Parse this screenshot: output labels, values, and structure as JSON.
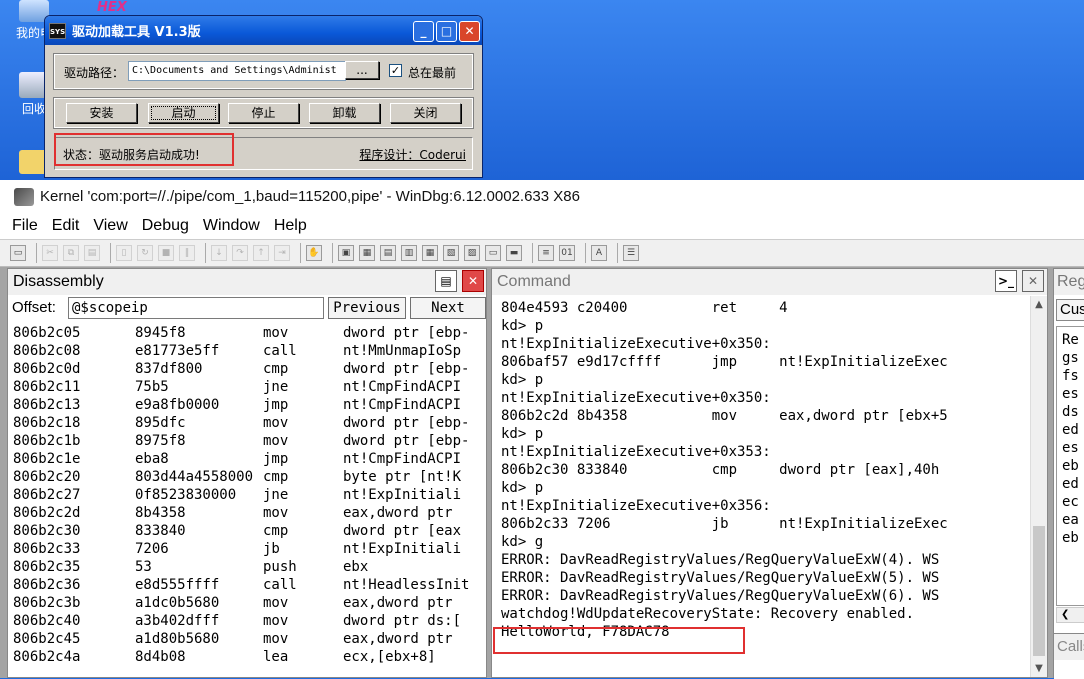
{
  "desktop": {
    "icon1_label": "我的电",
    "icon2_label": "回收",
    "hex_logo": "HEX"
  },
  "loader": {
    "title": "驱动加载工具 V1.3版",
    "app_icon": "SYS",
    "path_label": "驱动路径：",
    "path_value": "C:\\Documents and Settings\\Administ",
    "browse_label": "...",
    "topmost_label": "总在最前",
    "buttons": [
      "安装",
      "启动",
      "停止",
      "卸载",
      "关闭"
    ],
    "status": "状态：驱动服务启动成功!",
    "credit": "程序设计：Coderui",
    "titlebar_buttons": [
      "_",
      "□",
      "✕"
    ]
  },
  "windbg": {
    "title": "Kernel 'com:port=//./pipe/com_1,baud=115200,pipe' - WinDbg:6.12.0002.633 X86",
    "menu": [
      "File",
      "Edit",
      "View",
      "Debug",
      "Window",
      "Help"
    ]
  },
  "disassembly": {
    "title": "Disassembly",
    "offset_label": "Offset:",
    "offset_value": "@$scopeip",
    "previous_label": "Previous",
    "next_label": "Next",
    "rows": [
      [
        "806b2c05",
        "8945f8",
        "mov",
        "dword ptr [ebp-"
      ],
      [
        "806b2c08",
        "e81773e5ff",
        "call",
        "nt!MmUnmapIoSp"
      ],
      [
        "806b2c0d",
        "837df800",
        "cmp",
        "dword ptr [ebp-"
      ],
      [
        "806b2c11",
        "75b5",
        "jne",
        "nt!CmpFindACPI"
      ],
      [
        "806b2c13",
        "e9a8fb0000",
        "jmp",
        "nt!CmpFindACPI"
      ],
      [
        "806b2c18",
        "895dfc",
        "mov",
        "dword ptr [ebp-"
      ],
      [
        "806b2c1b",
        "8975f8",
        "mov",
        "dword ptr [ebp-"
      ],
      [
        "806b2c1e",
        "eba8",
        "jmp",
        "nt!CmpFindACPI"
      ],
      [
        "806b2c20",
        "803d44a4558000",
        "cmp",
        "byte ptr [nt!K"
      ],
      [
        "806b2c27",
        "0f8523830000",
        "jne",
        "nt!ExpInitiali"
      ],
      [
        "806b2c2d",
        "8b4358",
        "mov",
        "eax,dword ptr"
      ],
      [
        "806b2c30",
        "833840",
        "cmp",
        "dword ptr [eax"
      ],
      [
        "806b2c33",
        "7206",
        "jb",
        "nt!ExpInitiali"
      ],
      [
        "806b2c35",
        "53",
        "push",
        "ebx"
      ],
      [
        "806b2c36",
        "e8d555ffff",
        "call",
        "nt!HeadlessInit"
      ],
      [
        "806b2c3b",
        "a1dc0b5680",
        "mov",
        "eax,dword ptr"
      ],
      [
        "806b2c40",
        "a3b402dfff",
        "mov",
        "dword ptr ds:["
      ],
      [
        "806b2c45",
        "a1d80b5680",
        "mov",
        "eax,dword ptr"
      ],
      [
        "806b2c4a",
        "8d4b08",
        "lea",
        "ecx,[ebx+8]"
      ]
    ]
  },
  "command": {
    "title": "Command",
    "lines": [
      "804e4593 c20400          ret     4",
      "kd> p",
      "nt!ExpInitializeExecutive+0x350:",
      "806baf57 e9d17cffff      jmp     nt!ExpInitializeExec",
      "kd> p",
      "nt!ExpInitializeExecutive+0x350:",
      "806b2c2d 8b4358          mov     eax,dword ptr [ebx+5",
      "kd> p",
      "nt!ExpInitializeExecutive+0x353:",
      "806b2c30 833840          cmp     dword ptr [eax],40h",
      "kd> p",
      "nt!ExpInitializeExecutive+0x356:",
      "806b2c33 7206            jb      nt!ExpInitializeExec",
      "kd> g",
      "ERROR: DavReadRegistryValues/RegQueryValueExW(4). WS",
      "ERROR: DavReadRegistryValues/RegQueryValueExW(5). WS",
      "ERROR: DavReadRegistryValues/RegQueryValueExW(6). WS",
      "watchdog!WdUpdateRecoveryState: Recovery enabled.",
      "HelloWorld, F78DAC78"
    ]
  },
  "registers": {
    "title": "Reg",
    "customize_label": "Cus",
    "header": "Re",
    "items": [
      "gs",
      "fs",
      "es",
      "ds",
      "ed",
      "es",
      "eb",
      "ed",
      "ec",
      "ea",
      "eb"
    ],
    "calls_title": "Calls"
  }
}
